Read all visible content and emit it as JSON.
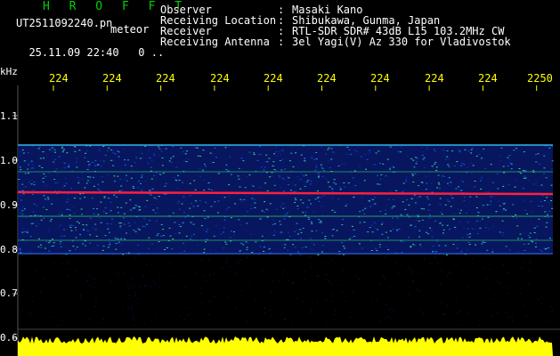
{
  "header": {
    "app_title": "H R O F F T",
    "file_name": "UT2511092240.pn",
    "detection_label": "meteor",
    "date_time": "25.11.09 22:40",
    "count_text": "0 ..",
    "info": [
      {
        "label": "Observer",
        "value": "Masaki Kano"
      },
      {
        "label": "Receiving Location",
        "value": "Shibukawa, Gunma, Japan"
      },
      {
        "label": "Receiver",
        "value": "RTL-SDR SDR# 43dB L15 103.2MHz CW"
      },
      {
        "label": "Receiving Antenna",
        "value": "3el Yagi(V) Az 330 for Vladivostok"
      }
    ]
  },
  "axis": {
    "y_unit": "kHz",
    "y_ticks": [
      "1.1",
      "1.0",
      "0.9",
      "0.8",
      "0.7",
      "0.6"
    ],
    "x_ticks": [
      "224",
      "224",
      "224",
      "224",
      "224",
      "224",
      "224",
      "224",
      "224",
      "2250"
    ]
  },
  "colors": {
    "title_green": "#00d000",
    "tick_yellow": "#ffff00",
    "noise_blue": "#1030c0",
    "signal_red": "#ff2040",
    "meteor_green": "#30e060",
    "signal_strip": "#ffff00"
  }
}
